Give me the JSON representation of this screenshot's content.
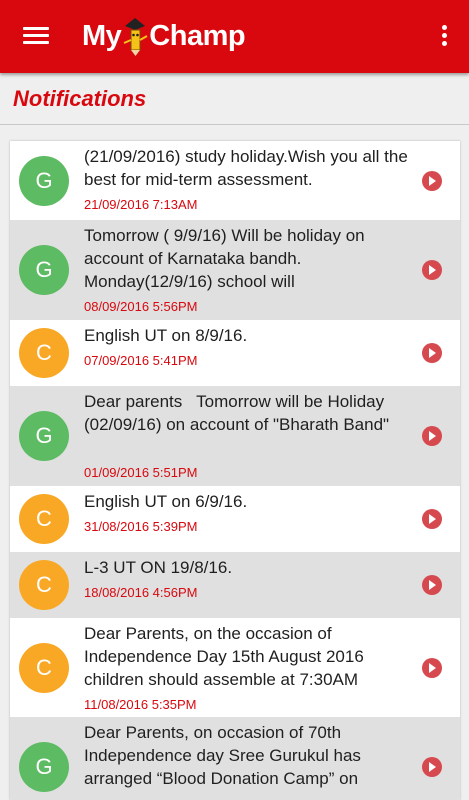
{
  "appbar": {
    "title_left": "My",
    "title_right": "Champ",
    "menu_icon": "hamburger-menu-icon",
    "overflow_icon": "more-vert-icon",
    "color": "#d9080f"
  },
  "page": {
    "title": "Notifications"
  },
  "notifications": [
    {
      "initial": "G",
      "text": "(21/09/2016) study holiday.Wish you all the best for mid-term assessment.",
      "time": "21/09/2016 7:13AM"
    },
    {
      "initial": "G",
      "text": "Tomorrow ( 9/9/16) Will be holiday on account of Karnataka bandh. Monday(12/9/16) school will",
      "time": "08/09/2016 5:56PM"
    },
    {
      "initial": "C",
      "text": "English UT on 8/9/16.",
      "time": "07/09/2016 5:41PM"
    },
    {
      "initial": "G",
      "text": "Dear parents   Tomorrow will be Holiday (02/09/16) on account of \"Bharath Band\"",
      "time": "01/09/2016 5:51PM"
    },
    {
      "initial": "C",
      "text": "English UT on 6/9/16.",
      "time": "31/08/2016 5:39PM"
    },
    {
      "initial": "C",
      "text": "L-3 UT ON 19/8/16.",
      "time": "18/08/2016 4:56PM"
    },
    {
      "initial": "C",
      "text": "Dear Parents, on the occasion of Independence Day 15th August 2016 children should assemble at 7:30AM",
      "time": "11/08/2016 5:35PM"
    },
    {
      "initial": "G",
      "text": "Dear Parents, on occasion of 70th Independence day Sree Gurukul has arranged “Blood Donation Camp” on",
      "time": ""
    }
  ],
  "colors": {
    "accent": "#d9080f",
    "avatar_g": "#5dbb63",
    "avatar_c": "#f8a825",
    "arrow": "#d64a4f"
  }
}
